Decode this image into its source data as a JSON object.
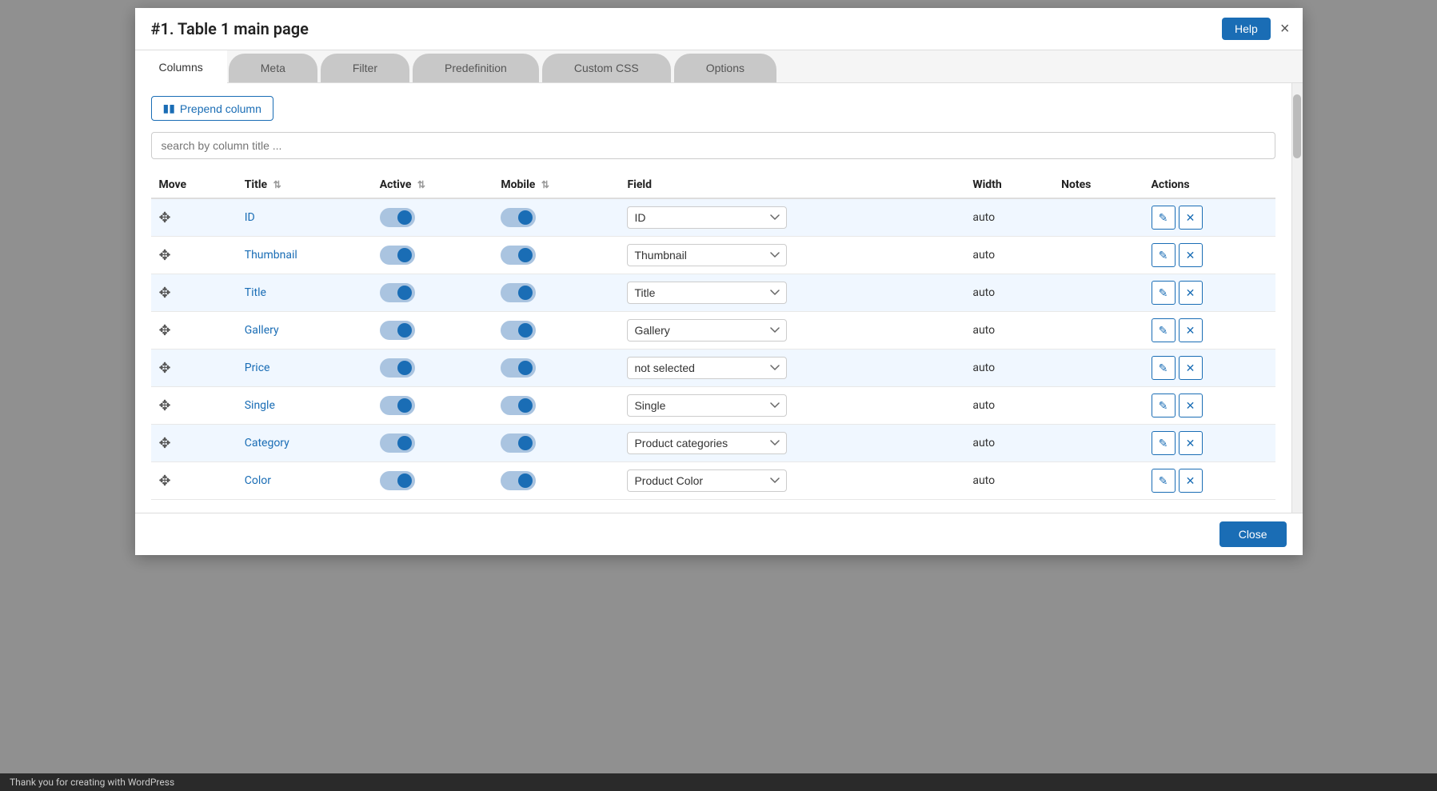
{
  "modal": {
    "title": "#1. Table 1 main page",
    "help_label": "Help",
    "close_label": "×"
  },
  "tabs": [
    {
      "id": "columns",
      "label": "Columns",
      "active": true
    },
    {
      "id": "meta",
      "label": "Meta",
      "active": false
    },
    {
      "id": "filter",
      "label": "Filter",
      "active": false
    },
    {
      "id": "predefinition",
      "label": "Predefinition",
      "active": false
    },
    {
      "id": "custom_css",
      "label": "Custom CSS",
      "active": false
    },
    {
      "id": "options",
      "label": "Options",
      "active": false
    }
  ],
  "toolbar": {
    "prepend_label": "Prepend column"
  },
  "search": {
    "placeholder": "search by column title ..."
  },
  "table": {
    "headers": [
      {
        "id": "move",
        "label": "Move",
        "sortable": false
      },
      {
        "id": "title",
        "label": "Title",
        "sortable": true
      },
      {
        "id": "active",
        "label": "Active",
        "sortable": true
      },
      {
        "id": "mobile",
        "label": "Mobile",
        "sortable": true
      },
      {
        "id": "field",
        "label": "Field",
        "sortable": false
      },
      {
        "id": "width",
        "label": "Width",
        "sortable": false
      },
      {
        "id": "notes",
        "label": "Notes",
        "sortable": false
      },
      {
        "id": "actions",
        "label": "Actions",
        "sortable": false
      }
    ],
    "rows": [
      {
        "id": "row-id",
        "title": "ID",
        "active": true,
        "mobile": true,
        "field": "ID",
        "field_options": [
          "ID",
          "Thumbnail",
          "Title",
          "Gallery",
          "not selected",
          "Single",
          "Product categories",
          "Product Color"
        ],
        "width": "auto",
        "notes": ""
      },
      {
        "id": "row-thumbnail",
        "title": "Thumbnail",
        "active": true,
        "mobile": true,
        "field": "Thumbnail",
        "field_options": [
          "ID",
          "Thumbnail",
          "Title",
          "Gallery",
          "not selected",
          "Single",
          "Product categories",
          "Product Color"
        ],
        "width": "auto",
        "notes": ""
      },
      {
        "id": "row-title",
        "title": "Title",
        "active": true,
        "mobile": true,
        "field": "Title",
        "field_options": [
          "ID",
          "Thumbnail",
          "Title",
          "Gallery",
          "not selected",
          "Single",
          "Product categories",
          "Product Color"
        ],
        "width": "auto",
        "notes": ""
      },
      {
        "id": "row-gallery",
        "title": "Gallery",
        "active": true,
        "mobile": true,
        "field": "Gallery",
        "field_options": [
          "ID",
          "Thumbnail",
          "Title",
          "Gallery",
          "not selected",
          "Single",
          "Product categories",
          "Product Color"
        ],
        "width": "auto",
        "notes": ""
      },
      {
        "id": "row-price",
        "title": "Price",
        "active": true,
        "mobile": true,
        "field": "not selected",
        "field_options": [
          "ID",
          "Thumbnail",
          "Title",
          "Gallery",
          "not selected",
          "Single",
          "Product categories",
          "Product Color"
        ],
        "width": "auto",
        "notes": ""
      },
      {
        "id": "row-single",
        "title": "Single",
        "active": true,
        "mobile": true,
        "field": "Single",
        "field_options": [
          "ID",
          "Thumbnail",
          "Title",
          "Gallery",
          "not selected",
          "Single",
          "Product categories",
          "Product Color"
        ],
        "width": "auto",
        "notes": ""
      },
      {
        "id": "row-category",
        "title": "Category",
        "active": true,
        "mobile": true,
        "field": "Product categories",
        "field_options": [
          "ID",
          "Thumbnail",
          "Title",
          "Gallery",
          "not selected",
          "Single",
          "Product categories",
          "Product Color"
        ],
        "width": "auto",
        "notes": ""
      },
      {
        "id": "row-color",
        "title": "Color",
        "active": true,
        "mobile": true,
        "field": "Product Color",
        "field_options": [
          "ID",
          "Thumbnail",
          "Title",
          "Gallery",
          "not selected",
          "Single",
          "Product categories",
          "Product Color"
        ],
        "width": "auto",
        "notes": ""
      }
    ]
  },
  "footer": {
    "close_label": "Close"
  },
  "bottom_bar": {
    "text": "Thank you for creating with WordPress"
  }
}
